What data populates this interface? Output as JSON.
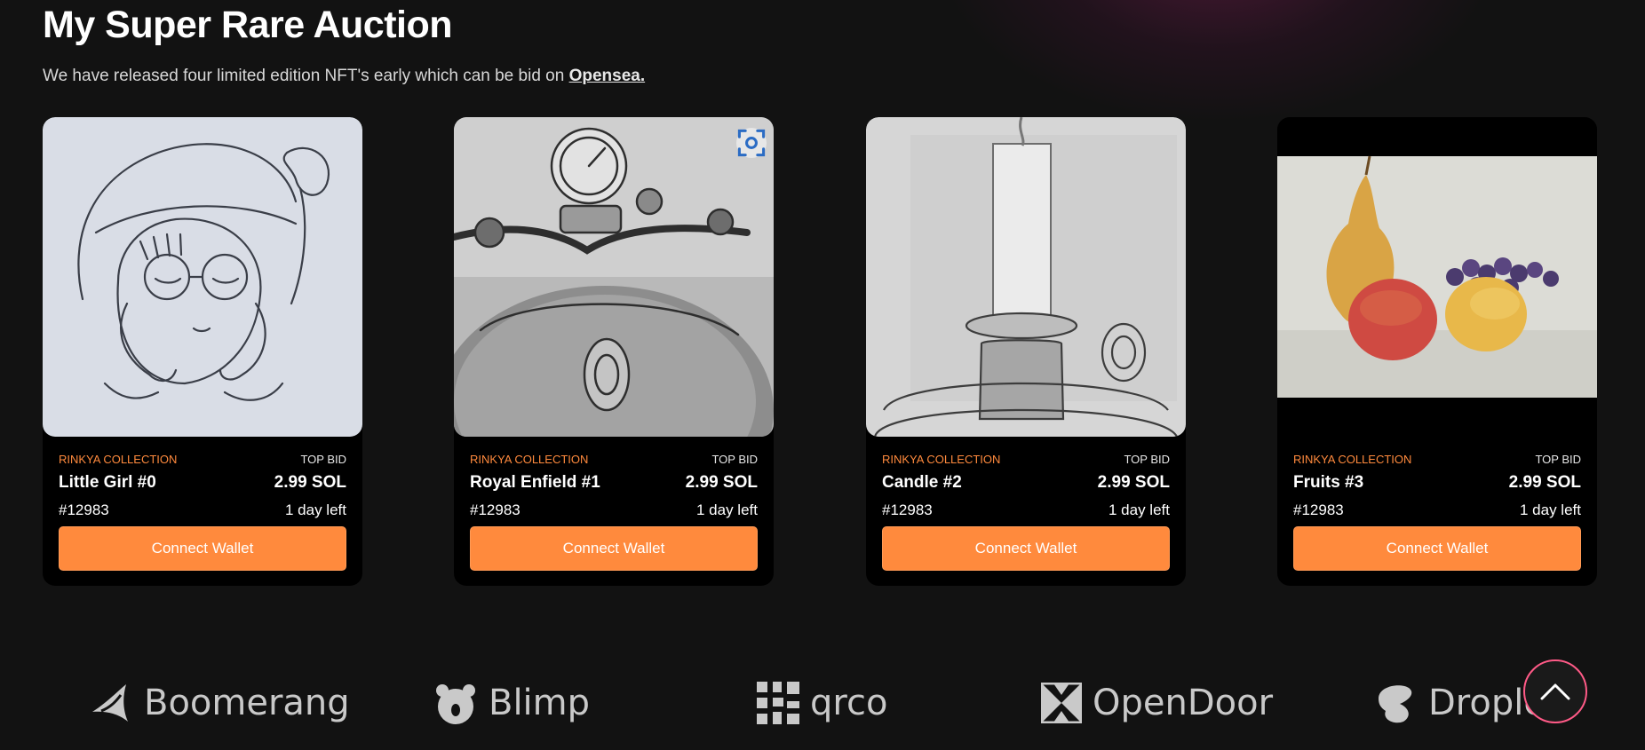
{
  "header": {
    "title": "My Super Rare Auction",
    "intro_text": "We have released four limited edition NFT's early which can be bid on ",
    "intro_link": "Opensea."
  },
  "cards": [
    {
      "collection": "RINKYA COLLECTION",
      "bid_label": "TOP BID",
      "name": "Little Girl #0",
      "price": "2.99 SOL",
      "token": "#12983",
      "time_left": "1 day left",
      "button": "Connect Wallet"
    },
    {
      "collection": "RINKYA COLLECTION",
      "bid_label": "TOP BID",
      "name": "Royal Enfield #1",
      "price": "2.99 SOL",
      "token": "#12983",
      "time_left": "1 day left",
      "button": "Connect Wallet"
    },
    {
      "collection": "RINKYA COLLECTION",
      "bid_label": "TOP BID",
      "name": "Candle #2",
      "price": "2.99 SOL",
      "token": "#12983",
      "time_left": "1 day left",
      "button": "Connect Wallet"
    },
    {
      "collection": "RINKYA COLLECTION",
      "bid_label": "TOP BID",
      "name": "Fruits #3",
      "price": "2.99 SOL",
      "token": "#12983",
      "time_left": "1 day left",
      "button": "Connect Wallet"
    }
  ],
  "partners": [
    "Boomerang",
    "Blimp",
    "qrco",
    "OpenDoor",
    "Droplet"
  ],
  "icons": {
    "scroll_top": "chevron-up-icon",
    "image_scan": "scan-icon"
  },
  "colors": {
    "accent": "#ff8a3d",
    "background": "#121212",
    "card": "#000000",
    "scroll_ring": "#ff5a87"
  }
}
